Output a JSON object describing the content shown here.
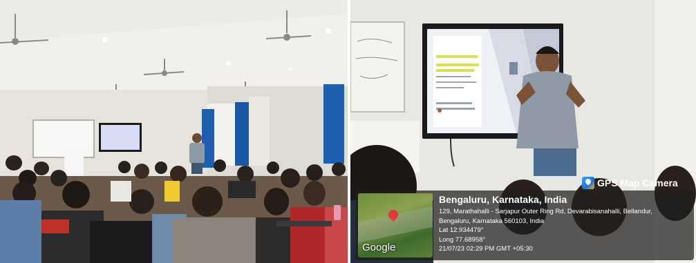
{
  "left_photo": {
    "description_icon": "classroom-icon",
    "colors": {
      "wall": "#e6e3da",
      "ceiling": "#f1f0ec",
      "curtain": "#1f5fb0",
      "floor": "#6b5a4a"
    }
  },
  "right_photo": {
    "description_icon": "presenter-icon",
    "colors": {
      "wall": "#e9e7e2",
      "screen_bezel": "#1a1a1a",
      "shirt": "#8e9aa6",
      "jeans": "#4b6c8f"
    }
  },
  "gps": {
    "badge_label": "GPS Map Camera",
    "badge_icon": "map-camera-icon",
    "title": "Bengaluru, Karnataka, India",
    "address_line1": "129, Marathahalli - Sarjapur Outer Ring Rd, Devarabisanahalli, Bellandur,",
    "address_line2": "Bengaluru, Karnataka 560103, India",
    "lat": "Lat 12.934479°",
    "long": "Long 77.68958°",
    "datetime": "21/07/23 02:29 PM GMT +05:30",
    "map_label": "Google"
  }
}
